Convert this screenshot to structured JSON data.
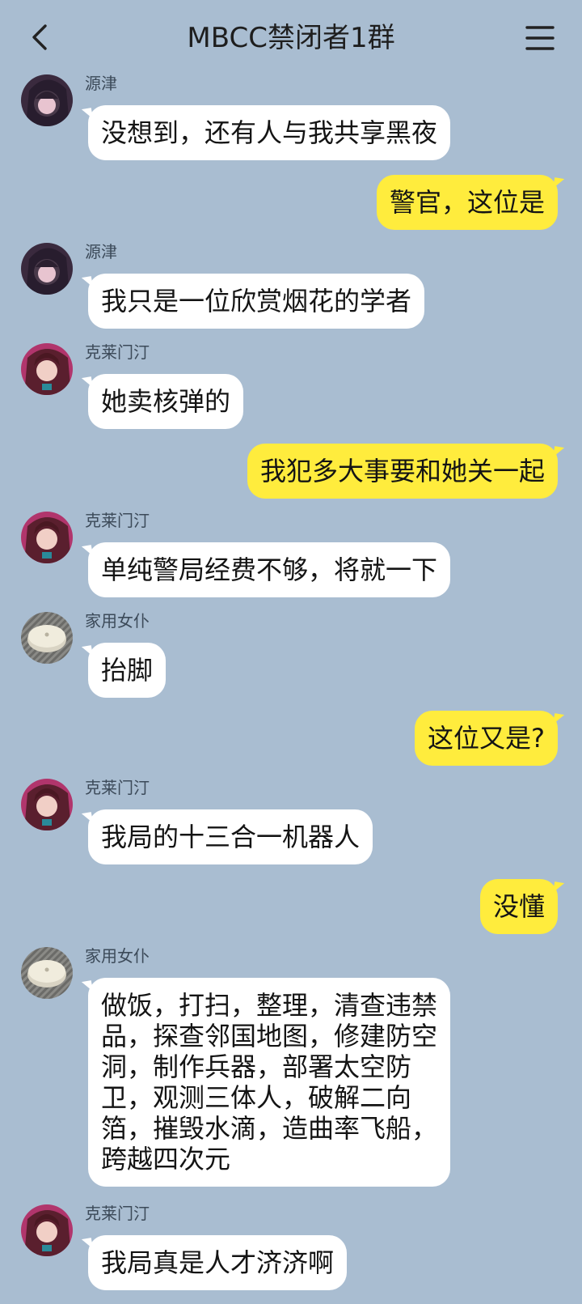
{
  "header": {
    "title": "MBCC禁闭者1群"
  },
  "messages": [
    {
      "sender": "源津",
      "text": "没想到，还有人与我共享黑夜"
    },
    {
      "text": "警官，这位是"
    },
    {
      "sender": "源津",
      "text": "我只是一位欣赏烟花的学者"
    },
    {
      "sender": "克莱门汀",
      "text": "她卖核弹的"
    },
    {
      "text": "我犯多大事要和她关一起"
    },
    {
      "sender": "克莱门汀",
      "text": "单纯警局经费不够，将就一下"
    },
    {
      "sender": "家用女仆",
      "text": "抬脚"
    },
    {
      "text": "这位又是?"
    },
    {
      "sender": "克莱门汀",
      "text": "我局的十三合一机器人"
    },
    {
      "text": "没懂"
    },
    {
      "sender": "家用女仆",
      "text": "做饭，打扫，整理，清查违禁\n品，探查邻国地图，修建防空\n洞，制作兵器，部署太空防\n卫，观测三体人，破解二向\n箔，摧毁水滴，造曲率飞船，\n跨越四次元"
    },
    {
      "sender": "克莱门汀",
      "text": "我局真是人才济济啊"
    }
  ]
}
